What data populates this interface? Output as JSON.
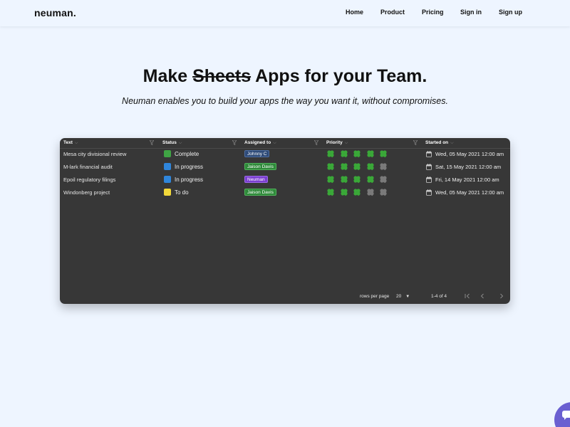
{
  "nav": {
    "logo": "neuman.",
    "links": [
      "Home",
      "Product",
      "Pricing",
      "Sign in",
      "Sign up"
    ]
  },
  "hero": {
    "title_before": "Make ",
    "title_strike": "Sheets",
    "title_after": " Apps for your Team.",
    "subtitle": "Neuman enables you to build your apps the way you want it, without compromises."
  },
  "table": {
    "columns": [
      "Text",
      "Status",
      "Assigned to",
      "Priority",
      "Started on"
    ],
    "rows": [
      {
        "text": "Mesa city divisional review",
        "status": "Complete",
        "status_color": "#3fa444",
        "assigned": "Johnny C",
        "assigned_color": "#2f4b78",
        "priority": 5,
        "started": "Wed, 05 May 2021 12:00 am"
      },
      {
        "text": "M-lark financial audit",
        "status": "In progress",
        "status_color": "#2f86dc",
        "assigned": "Jaison Davis",
        "assigned_color": "#2f8a3a",
        "priority": 4,
        "started": "Sat, 15 May 2021 12:00 am"
      },
      {
        "text": "Epoil regulatory filings",
        "status": "In progress",
        "status_color": "#2f86dc",
        "assigned": "Neuman",
        "assigned_color": "#7b3fd0",
        "priority": 4,
        "started": "Fri, 14 May 2021 12:00 am"
      },
      {
        "text": "Windonberg project",
        "status": "To do",
        "status_color": "#f2d83a",
        "assigned": "Jaison Davis",
        "assigned_color": "#2f8a3a",
        "priority": 3,
        "started": "Wed, 05 May 2021 12:00 am"
      }
    ],
    "priority_max": 5,
    "footer": {
      "rows_per_page_label": "rows per page",
      "rows_per_page_value": "20",
      "range": "1-4 of 4"
    }
  },
  "colors": {
    "page_bg": "#eef5ff",
    "table_bg": "#373737",
    "clover_on": "#3aa838",
    "clover_off": "#7a7a7a",
    "chat_bubble": "#6a5fd1"
  },
  "icons": {
    "filter": "filter-icon",
    "calendar": "calendar-icon",
    "clover": "clover-icon",
    "first_page": "first-page-icon",
    "prev_page": "prev-page-icon",
    "next_page": "next-page-icon",
    "chat": "chat-icon"
  }
}
